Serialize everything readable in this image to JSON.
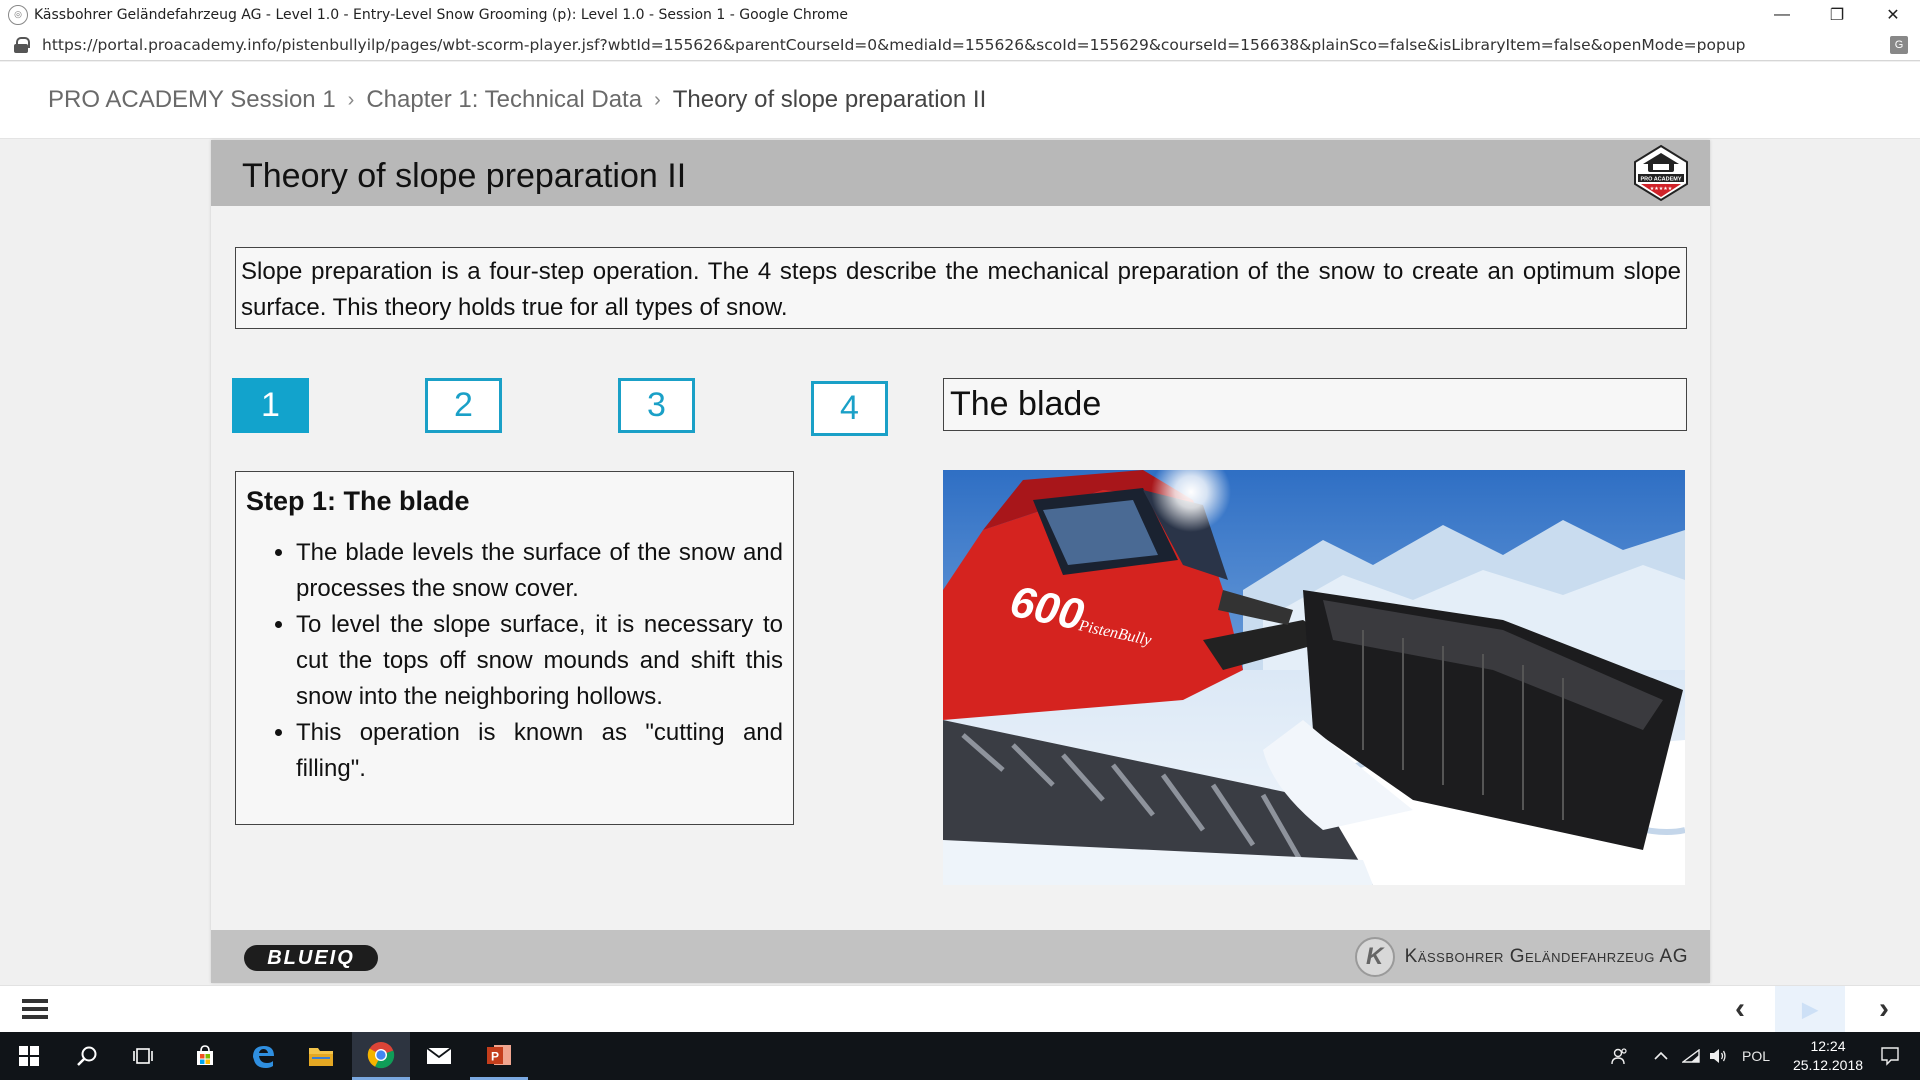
{
  "window": {
    "title": "Kässbohrer Geländefahrzeug AG - Level 1.0 - Entry-Level Snow Grooming (p): Level 1.0 - Session 1 - Google Chrome",
    "minimize_glyph": "—",
    "restore_glyph": "❐",
    "close_glyph": "✕"
  },
  "address": {
    "url": "https://portal.proacademy.info/pistenbullyilp/pages/wbt-scorm-player.jsf?wbtId=155626&parentCourseId=0&mediaId=155626&scoId=155629&courseId=156638&plainSco=false&isLibraryItem=false&openMode=popup"
  },
  "breadcrumb": {
    "items": [
      "PRO ACADEMY Session 1",
      "Chapter 1: Technical Data",
      "Theory of slope preparation II"
    ],
    "separator": "›"
  },
  "slide": {
    "title": "Theory of slope preparation II",
    "intro": "Slope preparation is a four-step operation. The 4 steps describe the mechanical preparation of the snow to create an optimum slope surface. This theory holds true for all types of snow.",
    "steps": [
      "1",
      "2",
      "3",
      "4"
    ],
    "active_step": 1,
    "step_heading": "The blade",
    "content_title": "Step 1: The blade",
    "bullets": [
      "The blade levels the surface of the snow and processes the snow cover.",
      "To level the slope surface, it is necessary to cut the tops off snow mounds and shift this snow into the neighboring hollows.",
      "This operation is known as \"cutting and filling\"."
    ],
    "logo_text": "PRO ACADEMY",
    "vehicle_model": "600",
    "vehicle_brand": "PistenBully",
    "footer_left": "BLUEIQ",
    "footer_right": "Kässbohrer Geländefahrzeug AG",
    "footer_right_initial": "K"
  },
  "player": {
    "prev_glyph": "‹",
    "play_glyph": "▶",
    "next_glyph": "›"
  },
  "taskbar": {
    "language": "POL",
    "time": "12:24",
    "date": "25.12.2018"
  },
  "colors": {
    "accent": "#12a3cc",
    "slide_header": "#b8b8b8",
    "taskbar": "#101418"
  }
}
